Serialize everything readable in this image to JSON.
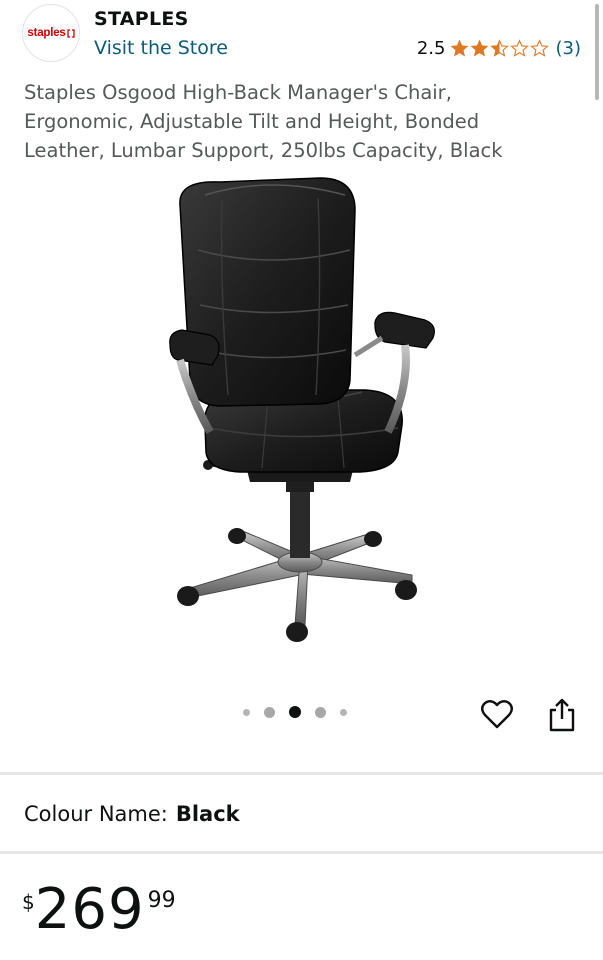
{
  "brand": {
    "logo_text": "staples",
    "name": "STAPLES",
    "store_link": "Visit the Store"
  },
  "rating": {
    "value": "2.5",
    "stars_filled": 2.5,
    "stars_total": 5,
    "count": "(3)",
    "star_color": "#de7921"
  },
  "product": {
    "title": "Staples Osgood High-Back Manager's Chair, Ergonomic, Adjustable Tilt and Height, Bonded Leather, Lumbar Support, 250lbs Capacity, Black",
    "image_icon": "office-chair-image",
    "carousel": {
      "total": 5,
      "active_index": 2
    }
  },
  "actions": {
    "wishlist_icon": "heart-outline-icon",
    "share_icon": "share-icon"
  },
  "variation": {
    "label": "Colour Name:",
    "value": "Black"
  },
  "price": {
    "symbol": "$",
    "whole": "269",
    "fraction": "99"
  },
  "colors": {
    "link": "#0b5c7a",
    "text": "#0f1111",
    "secondary_text": "#565959",
    "brand_red": "#cc0000"
  }
}
